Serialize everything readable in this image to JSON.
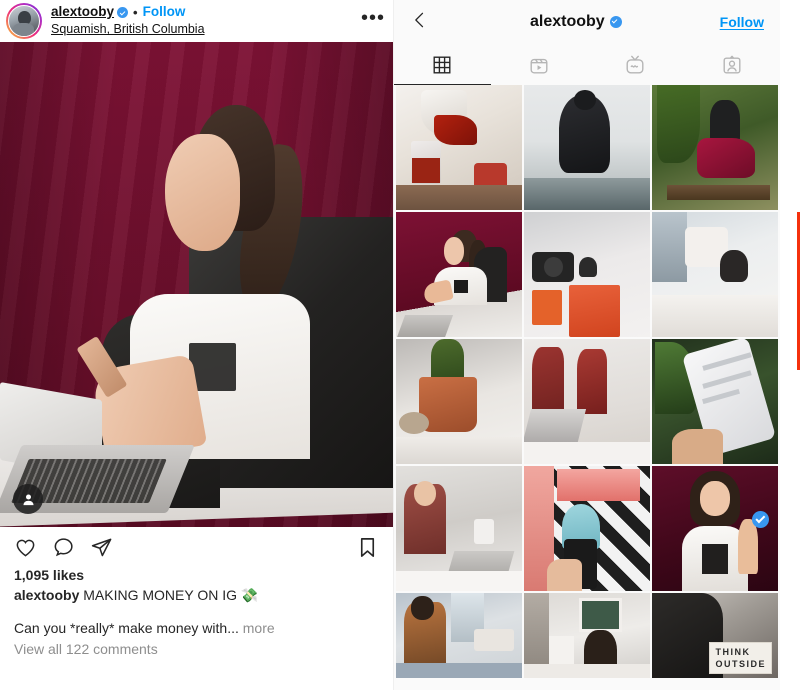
{
  "post": {
    "username": "alextooby",
    "verified": true,
    "separator": "•",
    "follow_label": "Follow",
    "location": "Squamish, British Columbia",
    "more_options": "•••",
    "tag_badge_icon": "person-tag-icon",
    "actions": {
      "like_icon": "heart-icon",
      "comment_icon": "comment-bubble-icon",
      "share_icon": "paper-plane-icon",
      "save_icon": "bookmark-icon"
    },
    "likes": "1,095 likes",
    "caption_user": "alextooby",
    "caption_title": "MAKING MONEY ON IG 💸",
    "caption_body": "Can you *really* make money with...",
    "more_label": "more",
    "comments_label": "View all 122 comments"
  },
  "profile": {
    "back_icon": "chevron-left-icon",
    "username": "alextooby",
    "verified": true,
    "follow_label": "Follow",
    "tabs": [
      {
        "name": "grid-tab",
        "icon": "grid-icon",
        "active": true
      },
      {
        "name": "reels-tab",
        "icon": "reels-icon",
        "active": false
      },
      {
        "name": "igtv-tab",
        "icon": "igtv-icon",
        "active": false
      },
      {
        "name": "tagged-tab",
        "icon": "tagged-icon",
        "active": false
      }
    ],
    "grid": [
      {
        "id": "tile-1",
        "desc": "pouring tea into glass",
        "verified_badge": false,
        "label": ""
      },
      {
        "id": "tile-2",
        "desc": "woman facing foggy lake",
        "verified_badge": false,
        "label": ""
      },
      {
        "id": "tile-3",
        "desc": "woman on swing in garden",
        "verified_badge": false,
        "label": ""
      },
      {
        "id": "tile-4",
        "desc": "woman at desk with phone",
        "verified_badge": false,
        "label": ""
      },
      {
        "id": "tile-5",
        "desc": "camera and books flatlay",
        "verified_badge": false,
        "label": ""
      },
      {
        "id": "tile-6",
        "desc": "woman sitting on bed",
        "verified_badge": false,
        "label": ""
      },
      {
        "id": "tile-7",
        "desc": "potted cactus on desk",
        "verified_badge": false,
        "label": ""
      },
      {
        "id": "tile-8",
        "desc": "woman with laptop in cafe",
        "verified_badge": false,
        "label": ""
      },
      {
        "id": "tile-9",
        "desc": "hand holding phone by plant",
        "verified_badge": false,
        "label": ""
      },
      {
        "id": "tile-10",
        "desc": "woman writing at laptop",
        "verified_badge": false,
        "label": ""
      },
      {
        "id": "tile-11",
        "desc": "ice cream cone at neon wall",
        "verified_badge": false,
        "label": ""
      },
      {
        "id": "tile-12",
        "desc": "woman pointing at badge",
        "verified_badge": true,
        "label": ""
      },
      {
        "id": "tile-13",
        "desc": "woman on couch with phone",
        "verified_badge": false,
        "label": ""
      },
      {
        "id": "tile-14",
        "desc": "woman sitting on bed by lamp",
        "verified_badge": false,
        "label": ""
      },
      {
        "id": "tile-15",
        "desc": "think outside the box sign",
        "verified_badge": false,
        "label": "THINK\nOUTSIDE"
      }
    ],
    "highlight_box_color": "#f5310d"
  },
  "colors": {
    "accent_blue": "#0095f6",
    "verified_blue": "#3897f0",
    "text_primary": "#262626",
    "text_secondary": "#8e8e8e",
    "highlight_red": "#f5310d",
    "post_backdrop": "#6b0f2b"
  }
}
